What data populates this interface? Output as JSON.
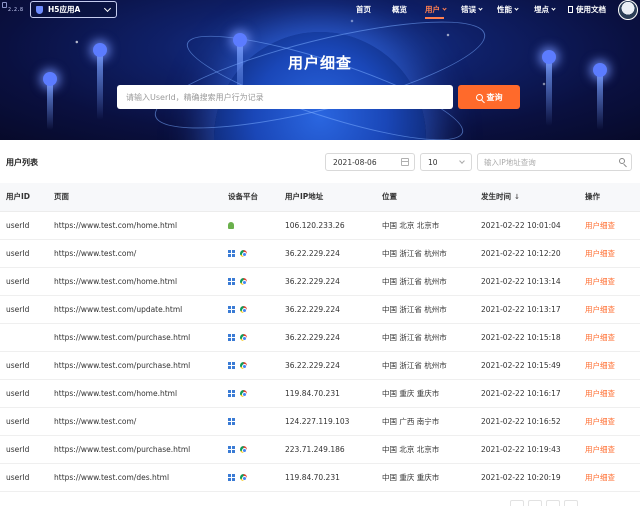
{
  "app": {
    "version": "2.2.8",
    "selected_app": "H5应用A"
  },
  "nav": {
    "items": [
      {
        "label": "首页",
        "dropdown": false,
        "active": false
      },
      {
        "label": "概览",
        "dropdown": false,
        "active": false
      },
      {
        "label": "用户",
        "dropdown": true,
        "active": true
      },
      {
        "label": "错误",
        "dropdown": true,
        "active": false
      },
      {
        "label": "性能",
        "dropdown": true,
        "active": false
      },
      {
        "label": "埋点",
        "dropdown": true,
        "active": false
      }
    ],
    "docs_label": "使用文档"
  },
  "hero": {
    "title": "用户细查",
    "search_placeholder": "请输入UserId，精确搜索用户行为记录",
    "search_button": "查询"
  },
  "list": {
    "title": "用户列表",
    "date": "2021-08-06",
    "page_size": "10",
    "ip_placeholder": "输入IP地址查询",
    "columns": [
      "用户ID",
      "页面",
      "设备平台",
      "用户IP地址",
      "位置",
      "发生时间",
      "操作"
    ],
    "sort_indicator": "↓",
    "rows": [
      {
        "user_id": "userId",
        "page": "https://www.test.com/home.html",
        "platform": [
          "android"
        ],
        "ip": "106.120.233.26",
        "location": "中国 北京 北京市",
        "time": "2021-02-22 10:01:04",
        "action": "用户细查"
      },
      {
        "user_id": "userId",
        "page": "https://www.test.com/",
        "platform": [
          "windows",
          "chrome"
        ],
        "ip": "36.22.229.224",
        "location": "中国 浙江省 杭州市",
        "time": "2021-02-22 10:12:20",
        "action": "用户细查"
      },
      {
        "user_id": "userId",
        "page": "https://www.test.com/home.html",
        "platform": [
          "windows",
          "chrome"
        ],
        "ip": "36.22.229.224",
        "location": "中国 浙江省 杭州市",
        "time": "2021-02-22 10:13:14",
        "action": "用户细查"
      },
      {
        "user_id": "userId",
        "page": "https://www.test.com/update.html",
        "platform": [
          "windows",
          "chrome"
        ],
        "ip": "36.22.229.224",
        "location": "中国 浙江省 杭州市",
        "time": "2021-02-22 10:13:17",
        "action": "用户细查"
      },
      {
        "user_id": "",
        "page": "https://www.test.com/purchase.html",
        "platform": [
          "windows",
          "chrome"
        ],
        "ip": "36.22.229.224",
        "location": "中国 浙江省 杭州市",
        "time": "2021-02-22 10:15:18",
        "action": "用户细查"
      },
      {
        "user_id": "userId",
        "page": "https://www.test.com/purchase.html",
        "platform": [
          "windows",
          "chrome"
        ],
        "ip": "36.22.229.224",
        "location": "中国 浙江省 杭州市",
        "time": "2021-02-22 10:15:49",
        "action": "用户细查"
      },
      {
        "user_id": "userId",
        "page": "https://www.test.com/home.html",
        "platform": [
          "windows",
          "chrome"
        ],
        "ip": "119.84.70.231",
        "location": "中国 重庆 重庆市",
        "time": "2021-02-22 10:16:17",
        "action": "用户细查"
      },
      {
        "user_id": "userId",
        "page": "https://www.test.com/",
        "platform": [
          "windows"
        ],
        "ip": "124.227.119.103",
        "location": "中国 广西 南宁市",
        "time": "2021-02-22 10:16:52",
        "action": "用户细查"
      },
      {
        "user_id": "userId",
        "page": "https://www.test.com/purchase.html",
        "platform": [
          "windows",
          "chrome"
        ],
        "ip": "223.71.249.186",
        "location": "中国 北京 北京市",
        "time": "2021-02-22 10:19:43",
        "action": "用户细查"
      },
      {
        "user_id": "userId",
        "page": "https://www.test.com/des.html",
        "platform": [
          "windows",
          "chrome"
        ],
        "ip": "119.84.70.231",
        "location": "中国 重庆 重庆市",
        "time": "2021-02-22 10:20:19",
        "action": "用户细查"
      }
    ]
  },
  "colors": {
    "accent": "#ff6a2b",
    "hero_bg": "#0a1040"
  }
}
